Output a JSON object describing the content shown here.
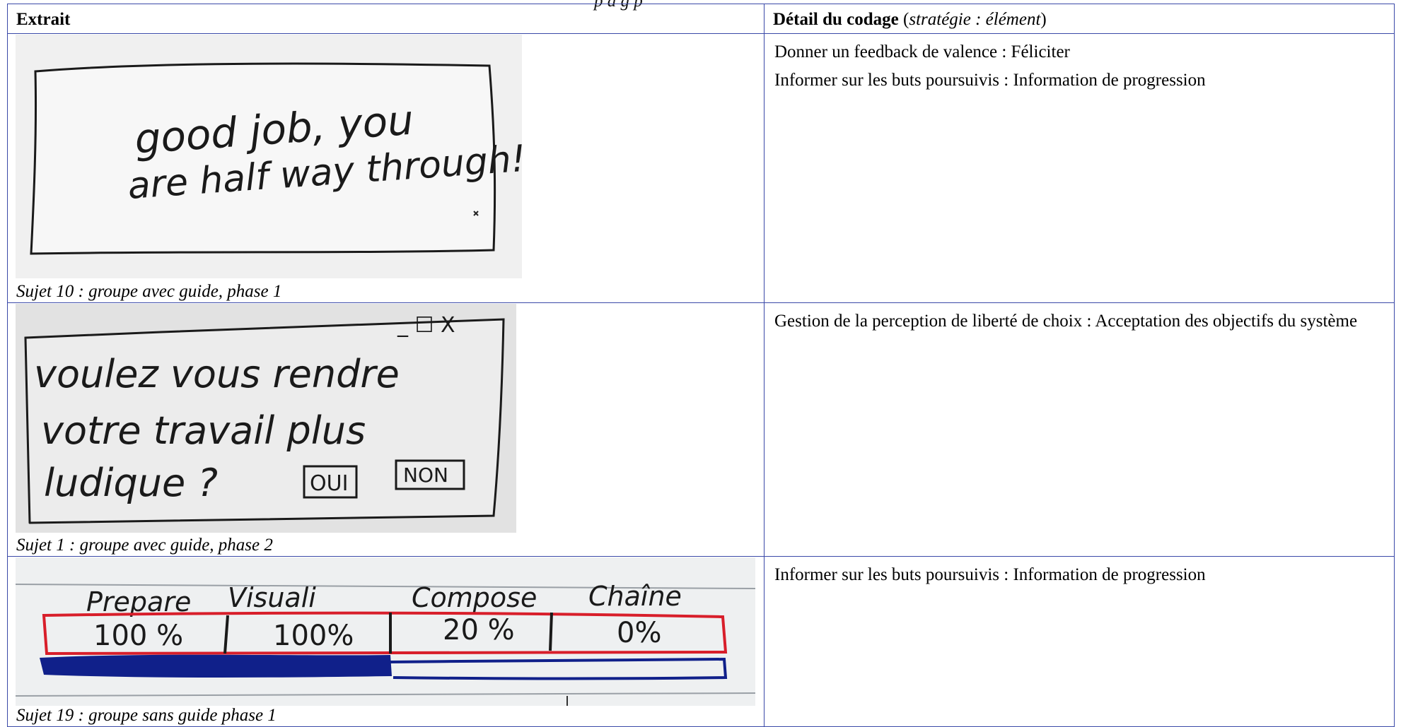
{
  "page_fragment": "p  d    g    p",
  "table": {
    "header": {
      "extract": "Extrait",
      "detail_bold": "Détail du codage",
      "detail_open": "(",
      "detail_italic": "stratégie : élément",
      "detail_close": ")"
    },
    "rows": [
      {
        "caption": "Sujet 10 : groupe avec guide, phase 1",
        "sketch": {
          "line1": "good job, you",
          "line2": "are half way through!"
        },
        "codes": [
          "Donner un feedback de valence : Féliciter",
          "Informer sur les buts poursuivis : Information de progression"
        ]
      },
      {
        "caption": "Sujet 1 : groupe avec guide, phase 2",
        "sketch": {
          "line1": "voulez vous rendre",
          "line2": "votre travail plus",
          "line3": "ludique ?",
          "yes": "OUI",
          "no": "NON",
          "window_controls": "_ ☐ X"
        },
        "codes": [
          "Gestion de la perception de liberté de choix : Acceptation des objectifs du système"
        ]
      },
      {
        "caption": "Sujet 19 : groupe sans guide phase 1",
        "sketch": {
          "steps": [
            {
              "label": "Prepare",
              "value": "100 %"
            },
            {
              "label": "Visuali",
              "value": "100%"
            },
            {
              "label": "Compose",
              "value": "20 %"
            },
            {
              "label": "Chaîne",
              "value": "0%"
            }
          ]
        },
        "codes": [
          "Informer sur les buts poursuivis : Information de progression"
        ]
      }
    ]
  }
}
